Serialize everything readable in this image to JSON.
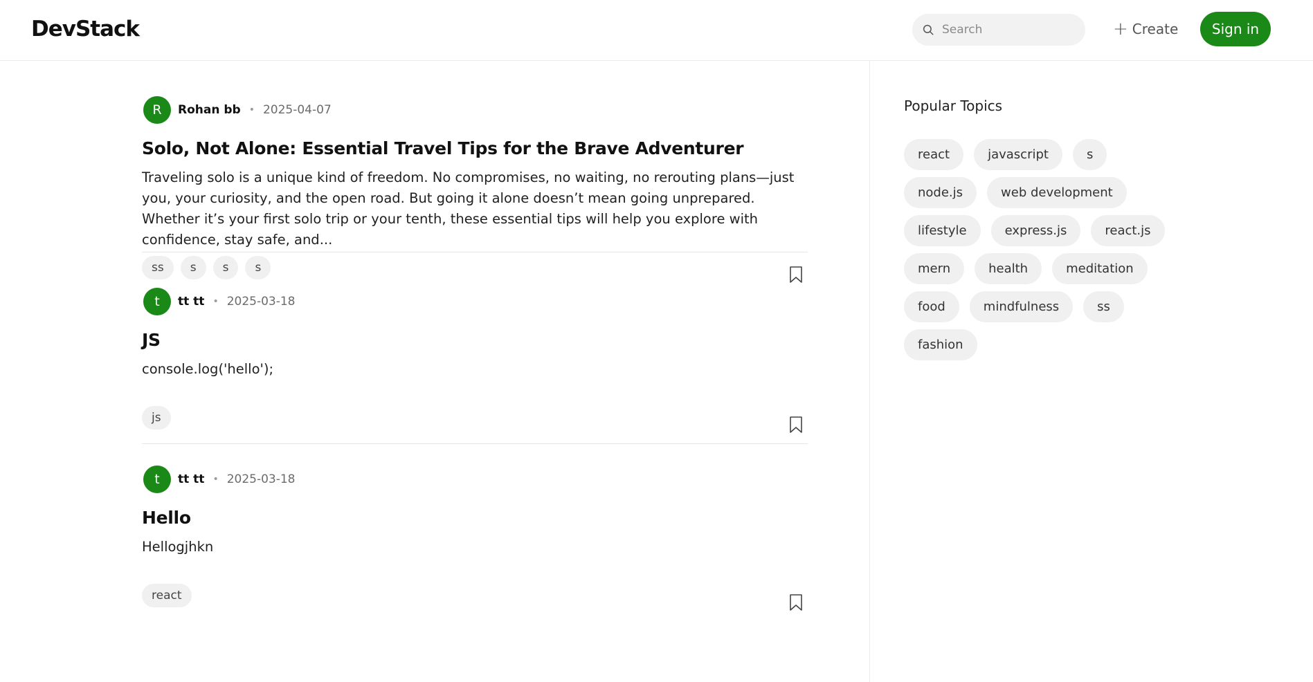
{
  "header": {
    "brand": "DevStack",
    "search_placeholder": "Search",
    "create_label": "Create",
    "signin_label": "Sign in",
    "accent": "#1a8917"
  },
  "articles": [
    {
      "avatar_letter": "R",
      "author": "Rohan bb",
      "date": "2025-04-07",
      "title": "Solo, Not Alone: Essential Travel Tips for the Brave Adventurer",
      "excerpt": "Traveling solo is a unique kind of freedom. No compromises, no waiting, no rerouting plans—just you, your curiosity, and the open road. But going it alone doesn’t mean going unprepared. Whether it’s your first solo trip or your tenth, these essential tips will help you explore with confidence, stay safe, and...",
      "tags": [
        "ss",
        "s",
        "s",
        "s"
      ]
    },
    {
      "avatar_letter": "t",
      "author": "tt tt",
      "date": "2025-03-18",
      "title": "JS",
      "excerpt": "console.log('hello');",
      "tags": [
        "js"
      ]
    },
    {
      "avatar_letter": "t",
      "author": "tt tt",
      "date": "2025-03-18",
      "title": "Hello",
      "excerpt": "Hellogjhkn",
      "tags": [
        "react"
      ]
    }
  ],
  "sidebar": {
    "title": "Popular Topics",
    "topics": [
      "react",
      "javascript",
      "s",
      "node.js",
      "web development",
      "lifestyle",
      "express.js",
      "react.js",
      "mern",
      "health",
      "meditation",
      "food",
      "mindfulness",
      "ss",
      "fashion"
    ]
  }
}
